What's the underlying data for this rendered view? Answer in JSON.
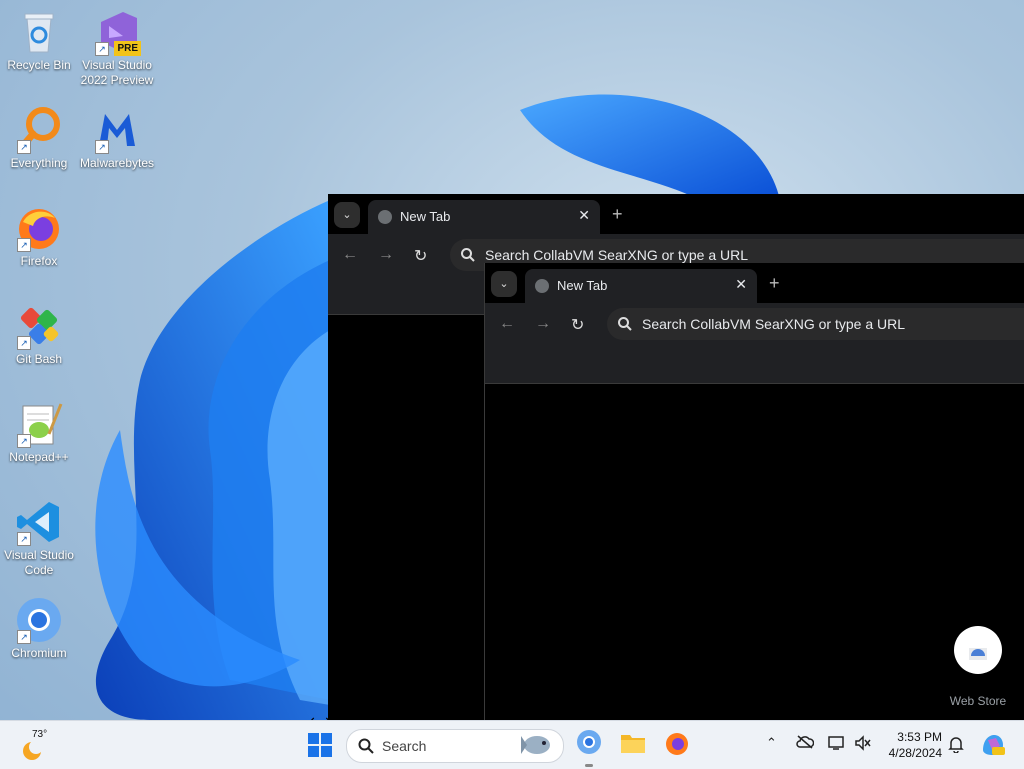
{
  "desktop": {
    "icons": [
      {
        "label": "Recycle Bin"
      },
      {
        "label": "Visual Studio 2022 Preview",
        "badge": "PRE"
      },
      {
        "label": "Everything"
      },
      {
        "label": "Malwarebytes"
      },
      {
        "label": "Firefox"
      },
      {
        "label": "Git Bash"
      },
      {
        "label": "Notepad++"
      },
      {
        "label": "Visual Studio Code"
      },
      {
        "label": "Chromium"
      }
    ]
  },
  "browser_back": {
    "tab_title": "New Tab",
    "omnibox_placeholder": "Search CollabVM SearXNG or type a URL"
  },
  "browser_front": {
    "tab_title": "New Tab",
    "omnibox_placeholder": "Search CollabVM SearXNG or type a URL",
    "shortcut_label": "Web Store"
  },
  "taskbar": {
    "weather_temp": "73°",
    "search_label": "Search",
    "time": "3:53 PM",
    "date": "4/28/2024",
    "colors": {
      "accent": "#1a73e8",
      "taskbar_bg": "#eef2f7"
    }
  }
}
